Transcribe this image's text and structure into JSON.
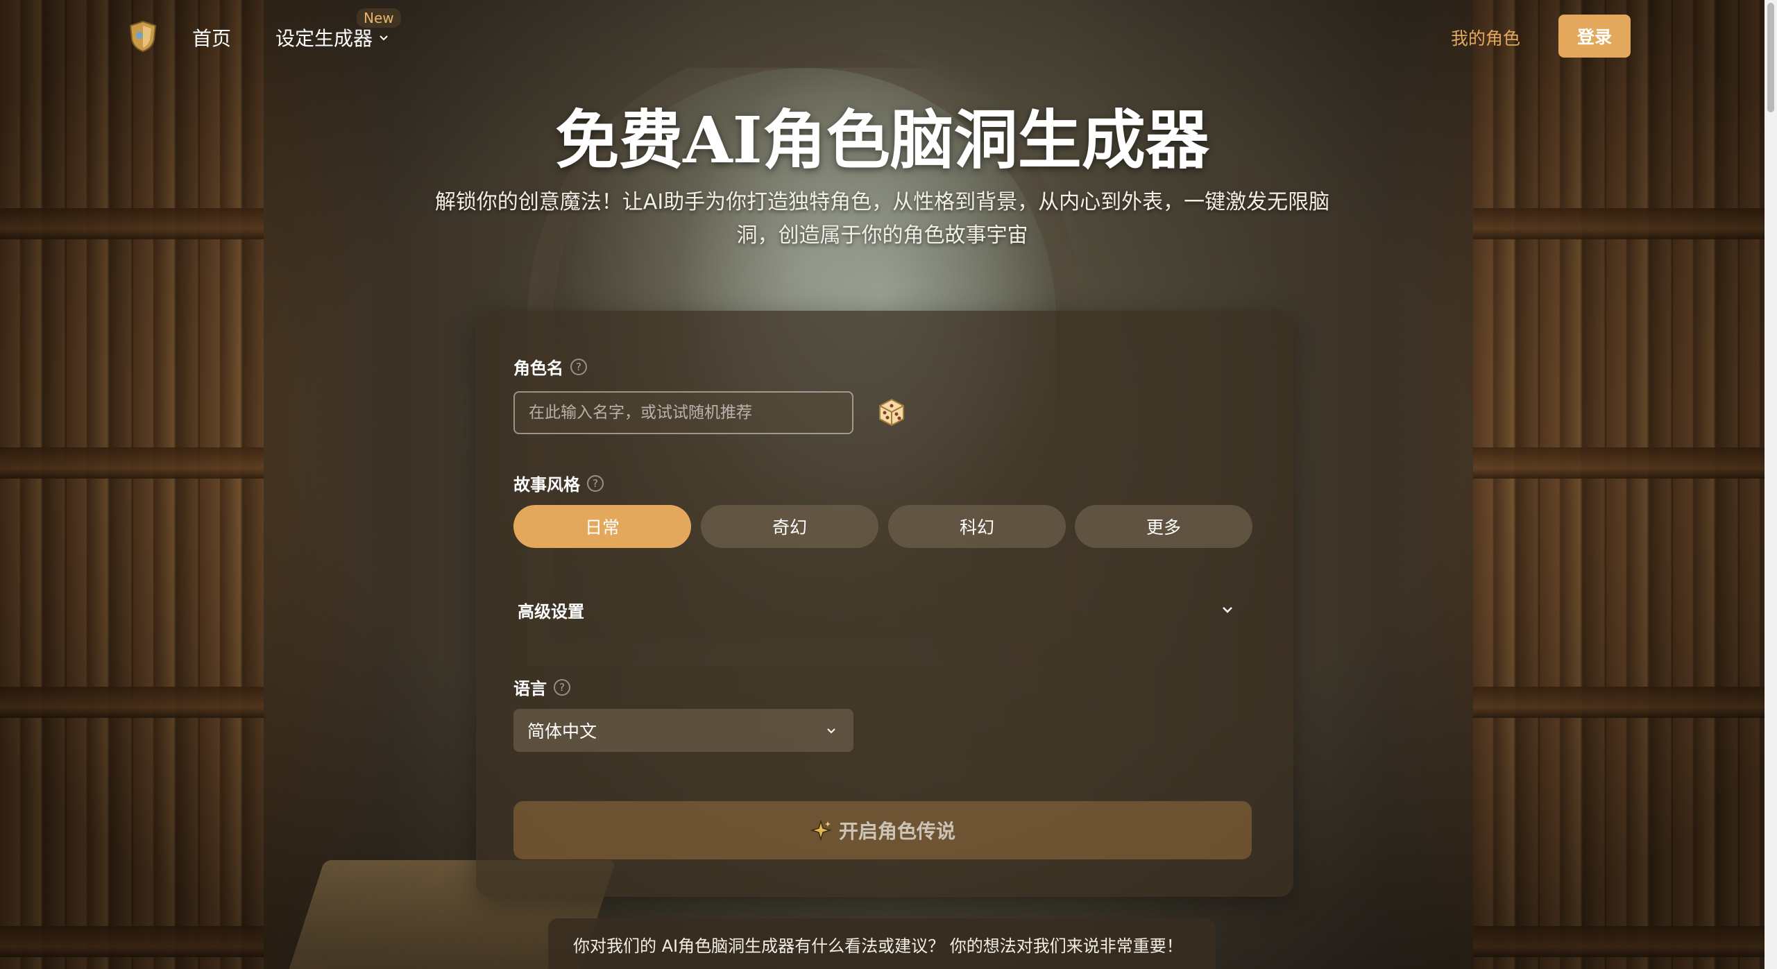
{
  "header": {
    "nav_home": "首页",
    "nav_generator": "设定生成器",
    "badge_new": "New",
    "my_characters": "我的角色",
    "login": "登录"
  },
  "hero": {
    "title": "免费AI角色脑洞生成器",
    "subtitle": "解锁你的创意魔法！让AI助手为你打造独特角色，从性格到背景，从内心到外表，一键激发无限脑洞，创造属于你的角色故事宇宙"
  },
  "form": {
    "name_label": "角色名",
    "name_placeholder": "在此输入名字，或试试随机推荐",
    "name_value": "",
    "style_label": "故事风格",
    "styles": [
      {
        "label": "日常",
        "active": true
      },
      {
        "label": "奇幻",
        "active": false
      },
      {
        "label": "科幻",
        "active": false
      },
      {
        "label": "更多",
        "active": false
      }
    ],
    "advanced_label": "高级设置",
    "language_label": "语言",
    "language_value": "简体中文",
    "submit_label": "开启角色传说"
  },
  "feedback": {
    "text": "你对我们的 AI角色脑洞生成器有什么看法或建议？ 你的想法对我们来说非常重要！"
  },
  "colors": {
    "accent": "#e3a85c",
    "panel": "#3c3022"
  }
}
